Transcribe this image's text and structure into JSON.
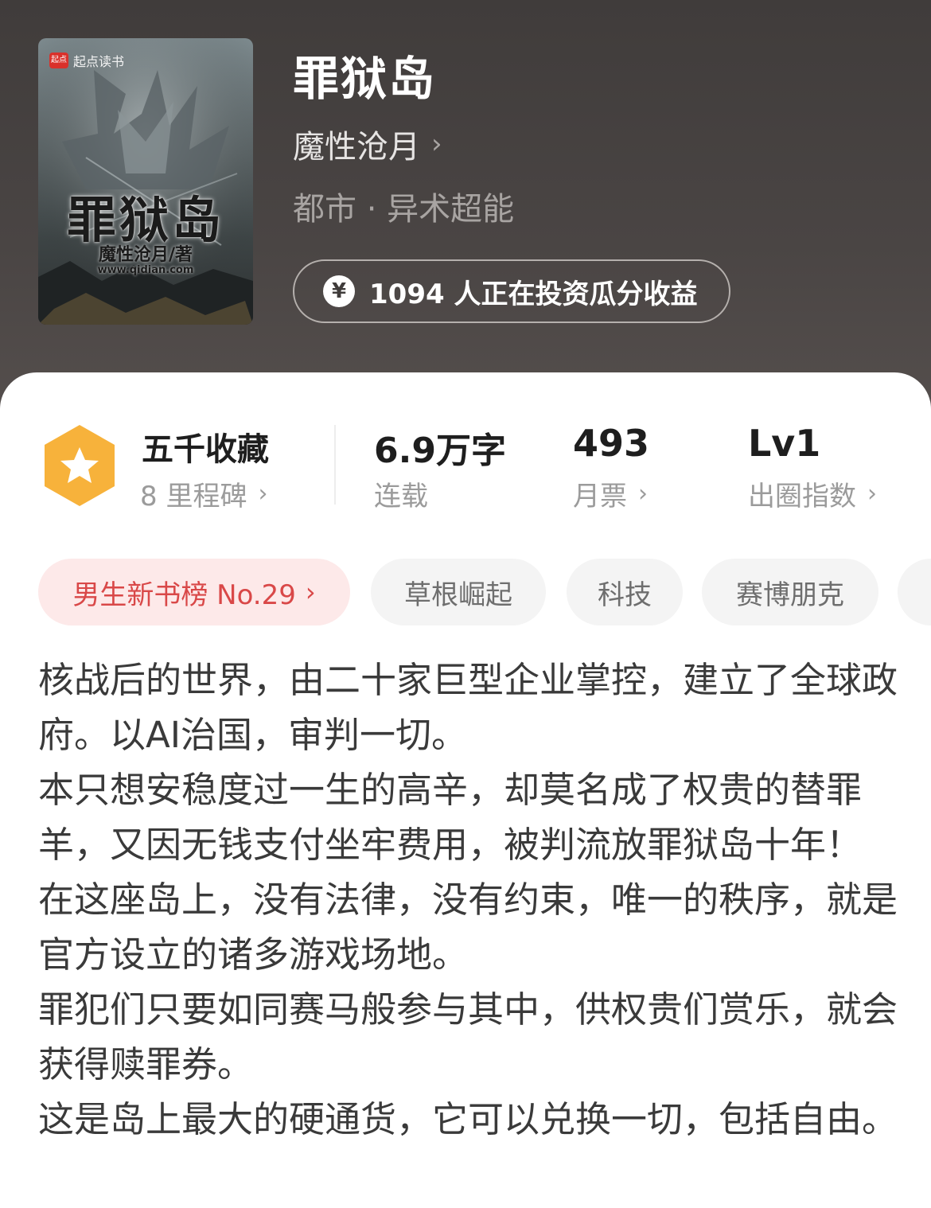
{
  "cover": {
    "brand_logo": "起点",
    "brand_text": "起点读书",
    "title": "罪狱岛",
    "author": "魔性沧月/著",
    "url": "www.qidian.com"
  },
  "book": {
    "title": "罪狱岛",
    "author": "魔性沧月",
    "genre": "都市 · 异术超能",
    "invest_text": "1094 人正在投资瓜分收益"
  },
  "stats": {
    "collect": {
      "value": "五千收藏",
      "label": "8 里程碑"
    },
    "words": {
      "value": "6.9万字",
      "label": "连载"
    },
    "tickets": {
      "value": "493",
      "label": "月票"
    },
    "level": {
      "value": "Lv1",
      "label": "出圈指数"
    }
  },
  "tags": [
    {
      "label": "男生新书榜 No.29"
    },
    {
      "label": "草根崛起"
    },
    {
      "label": "科技"
    },
    {
      "label": "赛博朋克"
    }
  ],
  "synopsis": [
    "核战后的世界，由二十家巨型企业掌控，建立了全球政府。以AI治国，审判一切。",
    "本只想安稳度过一生的高辛，却莫名成了权贵的替罪羊，又因无钱支付坐牢费用，被判流放罪狱岛十年！",
    "在这座岛上，没有法律，没有约束，唯一的秩序，就是官方设立的诸多游戏场地。",
    "罪犯们只要如同赛马般参与其中，供权贵们赏乐，就会获得赎罪券。",
    "这是岛上最大的硬通货，它可以兑换一切，包括自由。"
  ],
  "colors": {
    "header_bg": "#4a4544",
    "rank_tag_bg": "#fde9e9",
    "rank_tag_text": "#d94848",
    "badge": "#f7b23b"
  },
  "icons": {
    "chevron": "chevron-right-icon",
    "yen": "yen-coin-icon",
    "badge": "star-hexagon-icon"
  }
}
